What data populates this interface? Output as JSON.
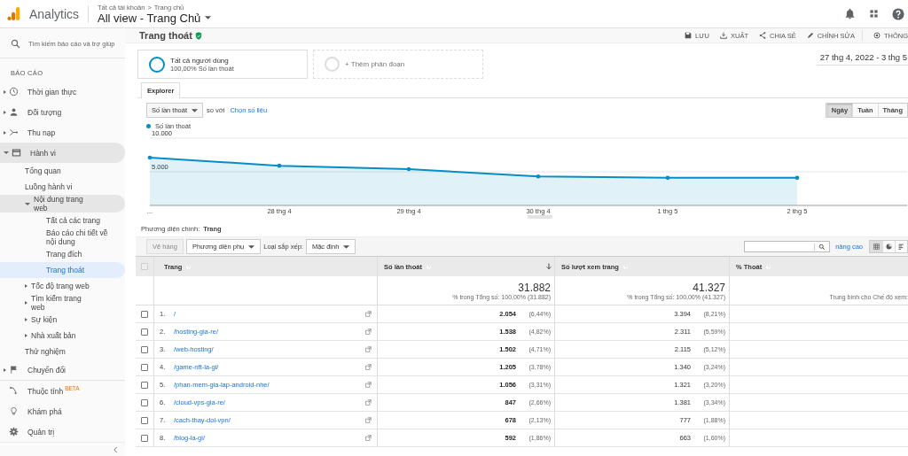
{
  "topbar": {
    "product": "Analytics",
    "breadcrumb": [
      "Tất cả tài khoản",
      "Trang chủ"
    ],
    "breadcrumb_separator": ">",
    "view": "All view - Trang Chủ"
  },
  "sidebar": {
    "search_placeholder": "Tìm kiếm báo cáo và trợ giúp",
    "section": "BÁO CÁO",
    "items": [
      {
        "label": "Thời gian thực",
        "expanded": false,
        "selected": false
      },
      {
        "label": "Đối tượng",
        "expanded": false,
        "selected": false
      },
      {
        "label": "Thu nạp",
        "expanded": false,
        "selected": false
      },
      {
        "label": "Hành vi",
        "expanded": true,
        "selected": false,
        "children": [
          {
            "label": "Tổng quan",
            "selected": false
          },
          {
            "label": "Luồng hành vi",
            "selected": false
          },
          {
            "label": "Nội dung trang web",
            "expanded": true,
            "selected": false,
            "children": [
              {
                "label": "Tất cả các trang",
                "selected": false
              },
              {
                "label": "Báo cáo chi tiết về nội dung",
                "selected": false
              },
              {
                "label": "Trang đích",
                "selected": false
              },
              {
                "label": "Trang thoát",
                "selected": true
              }
            ]
          },
          {
            "label": "Tốc độ trang web",
            "expanded": false,
            "selected": false
          },
          {
            "label": "Tìm kiếm trang web",
            "expanded": false,
            "selected": false
          },
          {
            "label": "Sự kiện",
            "expanded": false,
            "selected": false
          },
          {
            "label": "Nhà xuất bản",
            "expanded": false,
            "selected": false
          },
          {
            "label": "Thử nghiệm",
            "selected": false
          }
        ]
      },
      {
        "label": "Chuyển đổi",
        "expanded": false,
        "selected": false
      }
    ],
    "bottom_items": [
      {
        "label": "Thuộc tính",
        "badge": "BETA"
      },
      {
        "label": "Khám phá"
      },
      {
        "label": "Quản trị"
      }
    ]
  },
  "report": {
    "title": "Trang thoát",
    "actions": [
      "LƯU",
      "XUẤT",
      "CHIA SẺ",
      "CHỈNH SỬA",
      "THÔNG"
    ],
    "segments": [
      {
        "name": "Tất cả người dùng",
        "detail": "100,00% Số lần thoát",
        "kind": "active"
      },
      {
        "name": "+ Thêm phân đoạn",
        "kind": "add"
      }
    ],
    "date_range": "27 thg 4, 2022 - 3 thg 5",
    "tabs": [
      {
        "label": "Explorer",
        "selected": true
      }
    ],
    "metric": "Số lần thoát",
    "compare_label": "so với",
    "choose_metric": "Chọn số liệu",
    "granularity": [
      {
        "label": "Ngày",
        "selected": true
      },
      {
        "label": "Tuần",
        "selected": false
      },
      {
        "label": "Tháng",
        "selected": false
      }
    ],
    "chart_data": {
      "type": "area",
      "categories": [
        "...",
        "28 thg 4",
        "29 thg 4",
        "30 thg 4",
        "1 thg 5",
        "2 thg 5"
      ],
      "series": [
        {
          "name": "Số lần thoát",
          "color": "#058dc7",
          "values": [
            7100,
            5900,
            5400,
            4300,
            4100,
            4100
          ]
        }
      ],
      "ylim": [
        0,
        10000
      ],
      "yticks": [
        {
          "value": 5000,
          "label": "5.000"
        },
        {
          "value": 10000,
          "label": "10.000"
        }
      ]
    },
    "primary_dimension_label": "Phương diện chính:",
    "primary_dimension": "Trang",
    "plot_rows": {
      "label": "Vẽ hàng",
      "disabled": true
    },
    "secondary_dimension": "Phương diện phụ",
    "sort_label": "Loại sắp xếp:",
    "sort_value": "Mặc định",
    "advanced": "nâng cao",
    "views": [
      {
        "kind": "table",
        "selected": true
      },
      {
        "kind": "pie",
        "selected": false
      },
      {
        "kind": "bars",
        "selected": false
      }
    ]
  },
  "table": {
    "select_all_checked": false,
    "columns": [
      {
        "label": "Trang",
        "sorted": false
      },
      {
        "label": "Số lần thoát",
        "sorted": true
      },
      {
        "label": "Số lượt xem trang",
        "sorted": false
      },
      {
        "label": "% Thoát",
        "sorted": false
      }
    ],
    "totals": [
      {
        "value": "31.882",
        "note": "% trong Tổng số: 100,00% (31.882)"
      },
      {
        "value": "41.327",
        "note": "% trong Tổng số: 100,00% (41.327)"
      },
      {
        "note": "Trung bình cho Chế độ xem:"
      }
    ],
    "rows": [
      {
        "index": "1.",
        "page": "/",
        "exits": "2.054",
        "exits_share": "(6,44%)",
        "views": "3.394",
        "views_share": "(8,21%)",
        "checked": false
      },
      {
        "index": "2.",
        "page": "/hosting-gia-re/",
        "exits": "1.538",
        "exits_share": "(4,82%)",
        "views": "2.311",
        "views_share": "(5,59%)",
        "checked": false
      },
      {
        "index": "3.",
        "page": "/web-hosting/",
        "exits": "1.502",
        "exits_share": "(4,71%)",
        "views": "2.115",
        "views_share": "(5,12%)",
        "checked": false
      },
      {
        "index": "4.",
        "page": "/game-nft-la-gi/",
        "exits": "1.205",
        "exits_share": "(3,78%)",
        "views": "1.340",
        "views_share": "(3,24%)",
        "checked": false
      },
      {
        "index": "5.",
        "page": "/phan-mem-gia-lap-android-nhe/",
        "exits": "1.056",
        "exits_share": "(3,31%)",
        "views": "1.321",
        "views_share": "(3,20%)",
        "checked": false
      },
      {
        "index": "6.",
        "page": "/cloud-vps-gia-re/",
        "exits": "847",
        "exits_share": "(2,66%)",
        "views": "1.381",
        "views_share": "(3,34%)",
        "checked": false
      },
      {
        "index": "7.",
        "page": "/cach-thay-doi-vpn/",
        "exits": "678",
        "exits_share": "(2,13%)",
        "views": "777",
        "views_share": "(1,88%)",
        "checked": false
      },
      {
        "index": "8.",
        "page": "/blog-la-gi/",
        "exits": "592",
        "exits_share": "(1,86%)",
        "views": "663",
        "views_share": "(1,60%)",
        "checked": false
      }
    ]
  }
}
